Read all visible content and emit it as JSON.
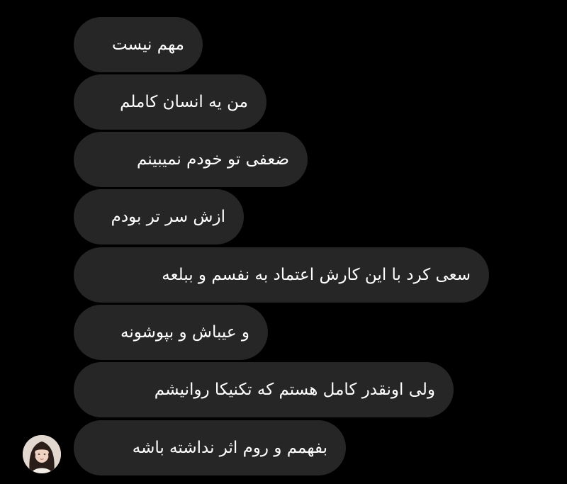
{
  "thread": {
    "bubble_color": "#262626",
    "text_color": "#ffffff",
    "background": "#000000",
    "messages": [
      {
        "text": "مهم نیست"
      },
      {
        "text": "من یه انسان کاملم"
      },
      {
        "text": "ضعفی تو خودم نمیبینم"
      },
      {
        "text": "ازش سر تر بودم"
      },
      {
        "text": "سعی کرد با این کارش اعتماد به نفسم و ببلعه"
      },
      {
        "text": "و عیباش و بپوشونه"
      },
      {
        "text": "ولی اونقدر کامل هستم که تکنیکا روانیشم"
      },
      {
        "text": "بفهمم و روم اثر نداشته باشه"
      }
    ]
  },
  "avatar": {
    "icon": "profile-photo"
  }
}
